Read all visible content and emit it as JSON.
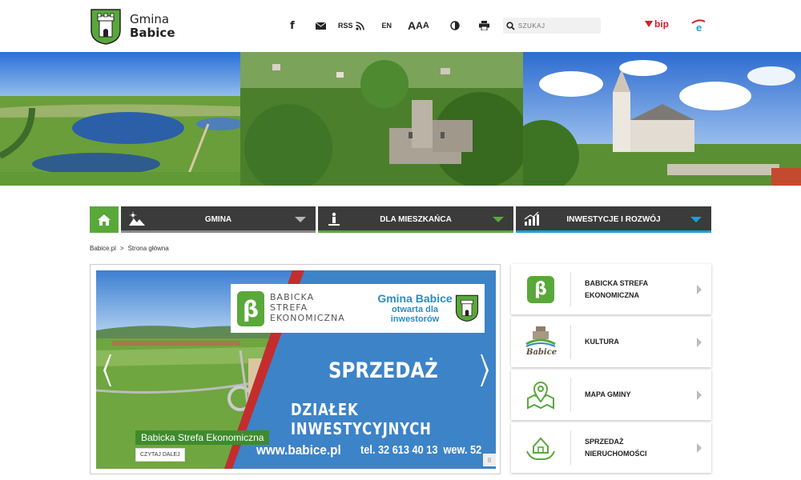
{
  "logo": {
    "line1": "Gmina",
    "line2": "Babice"
  },
  "toolbar": {
    "facebook": "f",
    "rss": "RSS",
    "lang": "EN",
    "font_size": {
      "a1": "A",
      "a2": "A",
      "a3": "A"
    },
    "search_placeholder": "SZUKAJ",
    "bip": "bip"
  },
  "nav": {
    "items": [
      {
        "label": "GMINA",
        "bar_color": "#8a8a8a",
        "arrow_color": "#b5b5b5"
      },
      {
        "label": "DLA MIESZKAŃCA",
        "bar_color": "#59a83a",
        "arrow_color": "#59a83a"
      },
      {
        "label": "INWESTYCJE I ROZWÓJ",
        "bar_color": "#1c9fd8",
        "arrow_color": "#1c9fd8"
      }
    ]
  },
  "breadcrumb": {
    "home": "Babice.pl",
    "sep": ">",
    "current": "Strona główna"
  },
  "slide": {
    "logo_line1": "BABICKA",
    "logo_line2": "STREFA",
    "logo_line3": "EKONOMICZNA",
    "gmina_line1": "Gmina Babice",
    "gmina_line2": "otwarta dla inwestorów",
    "headline1": "SPRZEDAŻ",
    "headline2": "DZIAŁEK INWESTYCYJNYCH",
    "url": "www.babice.pl",
    "phone": "tel. 32 613 40 13  wew. 52",
    "caption": "Babicka Strefa Ekonomiczna",
    "more": "CZYTAJ DALEJ",
    "pause": "II"
  },
  "quick_links": [
    {
      "label": "BABICKA STREFA\nEKONOMICZNA",
      "icon": "beta-icon"
    },
    {
      "label": "KULTURA",
      "icon": "babice-culture-icon",
      "icon_text": "Babice"
    },
    {
      "label": "MAPA GMINY",
      "icon": "map-pin-icon"
    },
    {
      "label": "SPRZEDAŻ\nNIERUCHOMOŚCI",
      "icon": "house-hands-icon"
    }
  ],
  "colors": {
    "green": "#59a83a",
    "dark_nav": "#3b3b3b",
    "blue": "#1c9fd8",
    "bip_red": "#d71f26"
  }
}
